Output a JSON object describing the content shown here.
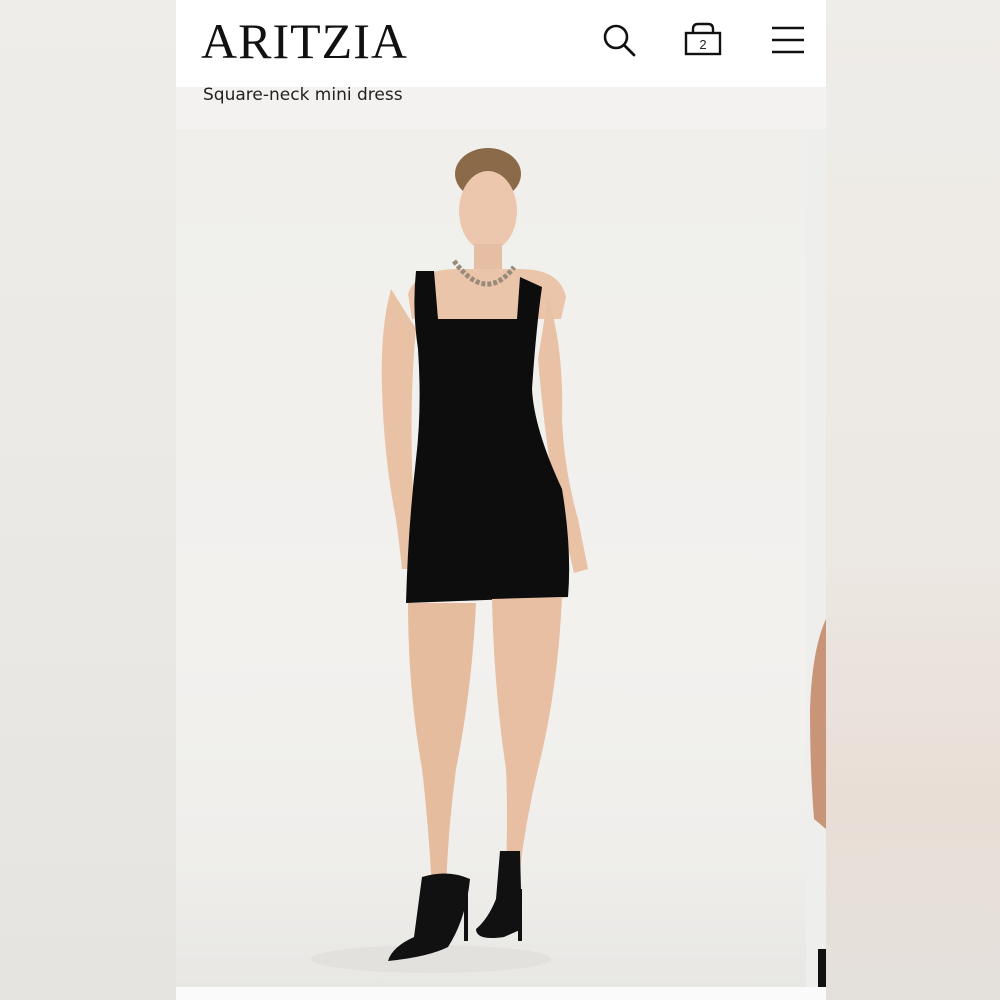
{
  "header": {
    "logo": "ARITZIA",
    "search_icon": "search-icon",
    "bag_icon": "shopping-bag-icon",
    "bag_count": "2",
    "menu_icon": "hamburger-menu-icon"
  },
  "product": {
    "name": "Square-neck mini dress"
  },
  "colors": {
    "header_bg": "#ffffff",
    "page_bg": "#f1f0ee",
    "dress": "#0d0d0d",
    "text": "#111111"
  }
}
